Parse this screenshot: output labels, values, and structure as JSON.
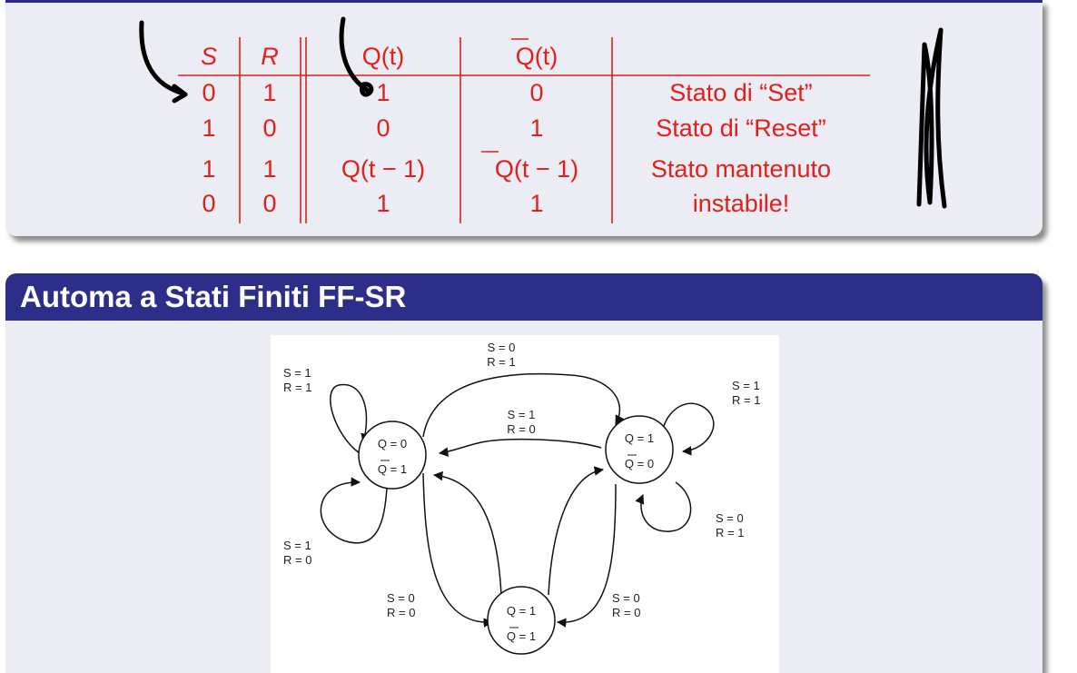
{
  "truth_table": {
    "headers": {
      "s": "S",
      "r": "R",
      "q": "Q(t)",
      "q_bar": "Q(t)"
    },
    "rows": [
      {
        "s": "0",
        "r": "1",
        "q": "1",
        "q_bar": "0",
        "state": [
          "Stato di “Set”"
        ]
      },
      {
        "s": "1",
        "r": "0",
        "q": "0",
        "q_bar": "1",
        "state": [
          "Stato di “Reset”"
        ]
      },
      {
        "s": "1",
        "r": "1",
        "q": "Q(t − 1)",
        "q_bar": "Q(t − 1)",
        "state": [
          "Stato mantenuto"
        ]
      },
      {
        "s": "0",
        "r": "0",
        "q": "1",
        "q_bar": "1",
        "state": [
          "instabile!"
        ]
      }
    ],
    "color": "#e0201a"
  },
  "automaton_block": {
    "title": "Automa a Stati Finiti FF-SR",
    "header_color": "#2d2d8a",
    "states": {
      "q0": {
        "line1": "Q = 0",
        "line2": "Q = 1"
      },
      "q1": {
        "line1": "Q = 1",
        "line2": "Q = 0"
      },
      "q11": {
        "line1": "Q = 1",
        "line2": "Q = 1"
      }
    },
    "labels": {
      "top_arc": [
        "S = 0",
        "R = 1"
      ],
      "mid_arc": [
        "S = 1",
        "R = 0"
      ],
      "q0_self_top": [
        "S = 1",
        "R = 1"
      ],
      "q0_self_bottom": [
        "S = 1",
        "R = 0"
      ],
      "q1_self_top": [
        "S = 1",
        "R = 1"
      ],
      "q1_self_bottom": [
        "S = 0",
        "R = 1"
      ],
      "left_bottom": [
        "S = 0",
        "R = 0"
      ],
      "right_bottom": [
        "S = 0",
        "R = 0"
      ]
    }
  }
}
